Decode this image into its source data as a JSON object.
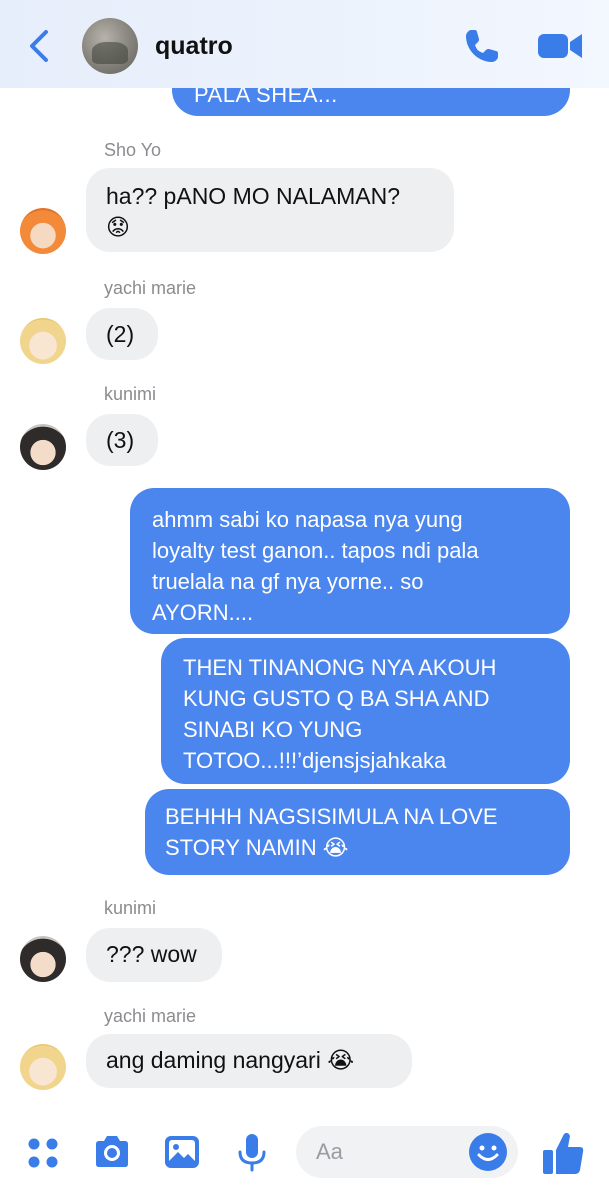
{
  "header": {
    "contact_name": "quatro",
    "back_icon": "chevron-left-icon",
    "call_icon": "phone-icon",
    "video_icon": "video-camera-icon",
    "accent_color": "#3a7ce8"
  },
  "messages": {
    "cut_off_outgoing": "PALA SHEA...",
    "sender_1": "Sho Yo",
    "msg_1": "ha?? pANO MO NALAMAN?",
    "msg_1_emoji": "😟",
    "sender_2": "yachi marie",
    "msg_2": "(2)",
    "sender_3": "kunimi",
    "msg_3": "(3)",
    "out_1_line1": "ahmm sabi ko napasa nya yung",
    "out_1_line2": "loyalty test ganon.. tapos ndi pala",
    "out_1_line3": "truelala na gf nya yorne.. so",
    "out_1_line4": "AYORN....",
    "out_2_line1": "THEN TINANONG NYA AKOUH",
    "out_2_line2": "KUNG GUSTO Q BA SHA AND",
    "out_2_line3": "SINABI KO YUNG",
    "out_2_line4": "TOTOO...!!!’djensjsjahkaka",
    "out_3_line1": "BEHHH NAGSISIMULA NA LOVE",
    "out_3_line2": "STORY NAMIN",
    "out_3_emoji": "😭",
    "sender_4": "kunimi",
    "msg_4": "??? wow",
    "sender_5": "yachi marie",
    "msg_5": "ang daming nangyari",
    "msg_5_emoji": "😭"
  },
  "composer": {
    "placeholder": "Aa",
    "icons": [
      "apps-icon",
      "camera-icon",
      "photo-icon",
      "microphone-icon",
      "emoji-icon",
      "thumbs-up-icon"
    ]
  },
  "colors": {
    "outgoing_bubble": "#4b86ee",
    "incoming_bubble": "#eeeff1",
    "icon_blue": "#3a7ce8"
  }
}
